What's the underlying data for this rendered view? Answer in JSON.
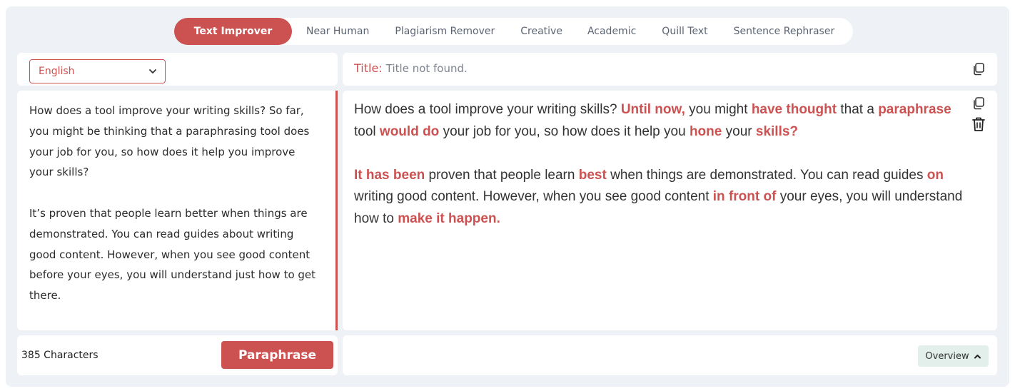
{
  "tabs": [
    {
      "label": "Text Improver",
      "active": true
    },
    {
      "label": "Near Human"
    },
    {
      "label": "Plagiarism Remover"
    },
    {
      "label": "Creative"
    },
    {
      "label": "Academic"
    },
    {
      "label": "Quill Text"
    },
    {
      "label": "Sentence Rephraser"
    }
  ],
  "language": {
    "selected": "English",
    "icon": "chevron-down-icon"
  },
  "title": {
    "label": "Title:",
    "value": "Title not found."
  },
  "input": {
    "paragraphs": [
      "How does a tool improve your writing skills? So far, you might be thinking that a paraphrasing tool does your job for you, so how does it help you improve your skills?",
      "It’s proven that people learn better when things are demonstrated. You can read guides about writing good content. However, when you see good content before your eyes, you will understand just how to get there."
    ]
  },
  "output": {
    "p1": [
      "How does a tool improve your writing skills? ",
      "Until now,",
      " you might ",
      "have thought",
      " that a ",
      "paraphrase",
      " tool ",
      "would do",
      " your job for you, so how does it help you ",
      "hone",
      " your ",
      "skills?"
    ],
    "p2": [
      "It has been",
      " proven that people learn ",
      "best",
      " when things are demonstrated. You can read guides ",
      "on",
      " writing good content. However, when you see good content ",
      "in front of",
      " your eyes, you will understand how to ",
      "make it happen."
    ]
  },
  "footer": {
    "char_count": "385 Characters",
    "paraphrase_label": "Paraphrase",
    "overview_label": "Overview"
  },
  "colors": {
    "accent": "#cc5252",
    "background": "#eef1f5",
    "overview_bg": "#e3efeb"
  },
  "icons": [
    "copy-icon",
    "trash-icon",
    "chevron-down-icon",
    "chevron-up-icon"
  ]
}
